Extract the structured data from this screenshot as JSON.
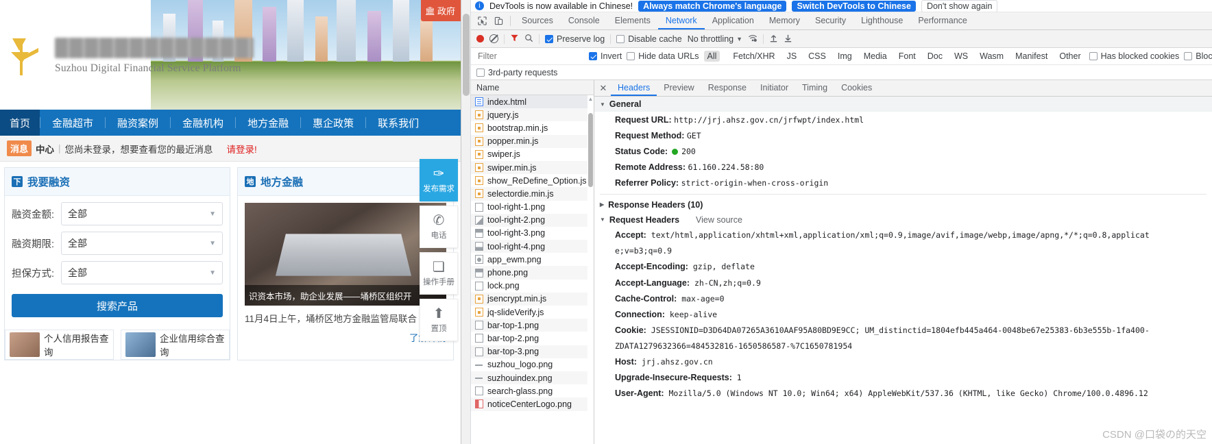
{
  "webpage": {
    "gov_badge": "政府",
    "brand_en": "Suzhou Digital Financial Service Platform",
    "nav": [
      {
        "label": "首页",
        "active": true
      },
      {
        "label": "金融超市",
        "active": false
      },
      {
        "label": "融资案例",
        "active": false
      },
      {
        "label": "金融机构",
        "active": false
      },
      {
        "label": "地方金融",
        "active": false
      },
      {
        "label": "惠企政策",
        "active": false
      },
      {
        "label": "联系我们",
        "active": false
      }
    ],
    "message_bar": {
      "tag": "消息",
      "center": "中心",
      "divider": "|",
      "text": "您尚未登录，想要查看您的最近消息",
      "login": "请登录!"
    },
    "finance_panel": {
      "icon": "下",
      "title": "我要融资",
      "rows": [
        {
          "label": "融资金额:",
          "value": "全部"
        },
        {
          "label": "融资期限:",
          "value": "全部"
        },
        {
          "label": "担保方式:",
          "value": "全部"
        }
      ],
      "search_button": "搜索产品",
      "cards": [
        {
          "label": "个人信用报告查询"
        },
        {
          "label": "企业信用综合查询"
        }
      ]
    },
    "local_panel": {
      "icon": "地",
      "title": "地方金融",
      "image_caption": "识资本市场，助企业发展——埇桥区组织开",
      "news_text": "11月4日上午，埇桥区地方金融监管局联合",
      "more": "了解详情"
    },
    "tool_rail": [
      {
        "glyph": "✑",
        "label": "发布需求",
        "primary": true
      },
      {
        "glyph": "✆",
        "label": "电话",
        "primary": false
      },
      {
        "glyph": "❏",
        "label": "操作手册",
        "primary": false
      },
      {
        "glyph": "⬆",
        "label": "置顶",
        "primary": false
      }
    ]
  },
  "devtools": {
    "banner": {
      "message": "DevTools is now available in Chinese!",
      "btn_match": "Always match Chrome's language",
      "btn_switch": "Switch DevTools to Chinese",
      "btn_dismiss": "Don't show again"
    },
    "tabs": [
      {
        "label": "Sources",
        "active": false
      },
      {
        "label": "Console",
        "active": false
      },
      {
        "label": "Elements",
        "active": false
      },
      {
        "label": "Network",
        "active": true
      },
      {
        "label": "Application",
        "active": false
      },
      {
        "label": "Memory",
        "active": false
      },
      {
        "label": "Security",
        "active": false
      },
      {
        "label": "Lighthouse",
        "active": false
      },
      {
        "label": "Performance",
        "active": false
      }
    ],
    "toolbar": {
      "preserve_log": "Preserve log",
      "preserve_log_checked": true,
      "disable_cache": "Disable cache",
      "disable_cache_checked": false,
      "throttling": "No throttling"
    },
    "filter_row": {
      "placeholder": "Filter",
      "invert": "Invert",
      "invert_checked": true,
      "hide_data_urls": "Hide data URLs",
      "hide_data_urls_checked": false,
      "types": [
        "All",
        "Fetch/XHR",
        "JS",
        "CSS",
        "Img",
        "Media",
        "Font",
        "Doc",
        "WS",
        "Wasm",
        "Manifest",
        "Other"
      ],
      "active_type": "All",
      "has_blocked_cookies": "Has blocked cookies",
      "blocked_requests": "Blocked",
      "third_party": "3rd-party requests"
    },
    "file_list": {
      "column": "Name",
      "rows": [
        {
          "name": "index.html",
          "kind": "html",
          "selected": true
        },
        {
          "name": "jquery.js",
          "kind": "js"
        },
        {
          "name": "bootstrap.min.js",
          "kind": "js"
        },
        {
          "name": "popper.min.js",
          "kind": "js"
        },
        {
          "name": "swiper.js",
          "kind": "js"
        },
        {
          "name": "swiper.min.js",
          "kind": "js"
        },
        {
          "name": "show_ReDefine_Option.js",
          "kind": "js"
        },
        {
          "name": "selectordie.min.js",
          "kind": "js"
        },
        {
          "name": "tool-right-1.png",
          "kind": "img"
        },
        {
          "name": "tool-right-2.png",
          "kind": "img2"
        },
        {
          "name": "tool-right-3.png",
          "kind": "img3"
        },
        {
          "name": "tool-right-4.png",
          "kind": "img5"
        },
        {
          "name": "app_ewm.png",
          "kind": "img4"
        },
        {
          "name": "phone.png",
          "kind": "img3"
        },
        {
          "name": "lock.png",
          "kind": "img"
        },
        {
          "name": "jsencrypt.min.js",
          "kind": "js"
        },
        {
          "name": "jq-slideVerify.js",
          "kind": "js"
        },
        {
          "name": "bar-top-1.png",
          "kind": "img"
        },
        {
          "name": "bar-top-2.png",
          "kind": "img"
        },
        {
          "name": "bar-top-3.png",
          "kind": "img"
        },
        {
          "name": "suzhou_logo.png",
          "kind": "dash"
        },
        {
          "name": "suzhouindex.png",
          "kind": "dash"
        },
        {
          "name": "search-glass.png",
          "kind": "img"
        },
        {
          "name": "noticeCenterLogo.png",
          "kind": "img6"
        }
      ]
    },
    "detail_tabs": [
      {
        "label": "Headers",
        "active": true
      },
      {
        "label": "Preview",
        "active": false
      },
      {
        "label": "Response",
        "active": false
      },
      {
        "label": "Initiator",
        "active": false
      },
      {
        "label": "Timing",
        "active": false
      },
      {
        "label": "Cookies",
        "active": false
      }
    ],
    "general": {
      "title": "General",
      "request_url_key": "Request URL:",
      "request_url_val": "http://jrj.ahsz.gov.cn/jrfwpt/index.html",
      "request_method_key": "Request Method:",
      "request_method_val": "GET",
      "status_key": "Status Code:",
      "status_val": "200",
      "remote_key": "Remote Address:",
      "remote_val": "61.160.224.58:80",
      "referrer_key": "Referrer Policy:",
      "referrer_val": "strict-origin-when-cross-origin"
    },
    "response_headers_title": "Response Headers (10)",
    "request_headers_title": "Request Headers",
    "view_source": "View source",
    "request_headers": [
      {
        "key": "Accept:",
        "val": "text/html,application/xhtml+xml,application/xml;q=0.9,image/avif,image/webp,image/apng,*/*;q=0.8,applicat",
        "cont": "e;v=b3;q=0.9"
      },
      {
        "key": "Accept-Encoding:",
        "val": "gzip, deflate"
      },
      {
        "key": "Accept-Language:",
        "val": "zh-CN,zh;q=0.9"
      },
      {
        "key": "Cache-Control:",
        "val": "max-age=0"
      },
      {
        "key": "Connection:",
        "val": "keep-alive"
      },
      {
        "key": "Cookie:",
        "val": "JSESSIONID=D3D64DA07265A3610AAF95A80BD9E9CC; UM_distinctid=1804efb445a464-0048be67e25383-6b3e555b-1fa400-",
        "cont": "ZDATA1279632366=484532816-1650586587-%7C1650781954"
      },
      {
        "key": "Host:",
        "val": "jrj.ahsz.gov.cn"
      },
      {
        "key": "Upgrade-Insecure-Requests:",
        "val": "1"
      },
      {
        "key": "User-Agent:",
        "val": "Mozilla/5.0 (Windows NT 10.0; Win64; x64) AppleWebKit/537.36 (KHTML, like Gecko) Chrome/100.0.4896.12"
      }
    ],
    "watermark": "CSDN @口袋の的天空"
  }
}
